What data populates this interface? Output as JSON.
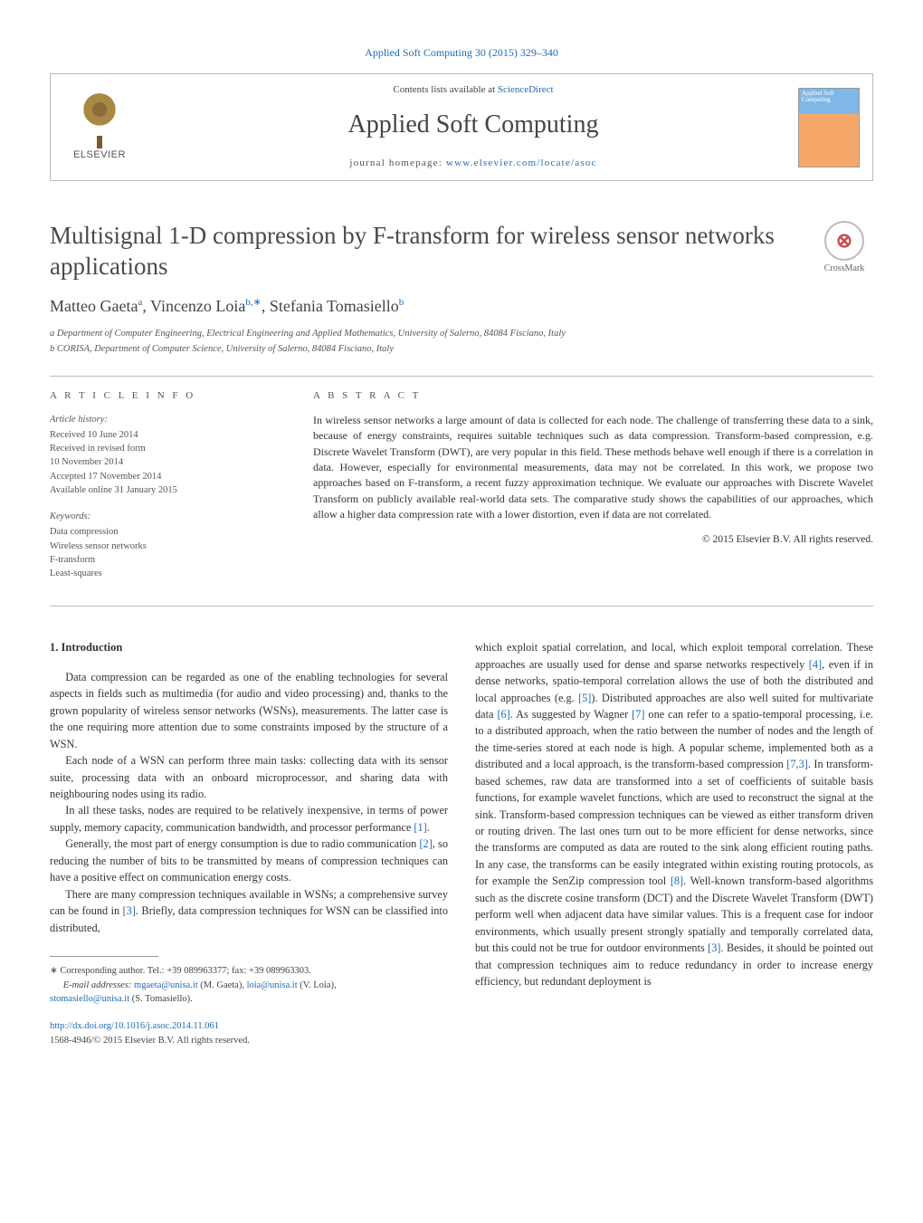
{
  "journal_ref": {
    "text": "Applied Soft Computing 30 (2015) 329–340",
    "href_text": "Applied Soft Computing 30 (2015) 329–340"
  },
  "header": {
    "elsevier": "ELSEVIER",
    "contents_prefix": "Contents lists available at ",
    "contents_link": "ScienceDirect",
    "journal_name": "Applied Soft Computing",
    "homepage_prefix": "journal homepage: ",
    "homepage_link": "www.elsevier.com/locate/asoc",
    "cover_text": "Applied Soft Computing"
  },
  "title": "Multisignal 1-D compression by F-transform for wireless sensor networks applications",
  "crossmark": "CrossMark",
  "authors_html": "Matteo Gaeta",
  "authors": {
    "a1_name": "Matteo Gaeta",
    "a1_sup": "a",
    "sep1": ", ",
    "a2_name": "Vincenzo Loia",
    "a2_sup": "b,",
    "a2_star": "∗",
    "sep2": ", ",
    "a3_name": "Stefania Tomasiello",
    "a3_sup": "b"
  },
  "affiliations": {
    "a": "a Department of Computer Engineering, Electrical Engineering and Applied Mathematics, University of Salerno, 84084 Fisciano, Italy",
    "b": "b CORISA, Department of Computer Science, University of Salerno, 84084 Fisciano, Italy"
  },
  "article_info": {
    "heading": "A R T I C L E   I N F O",
    "history_label": "Article history:",
    "history": [
      "Received 10 June 2014",
      "Received in revised form",
      "10 November 2014",
      "Accepted 17 November 2014",
      "Available online 31 January 2015"
    ],
    "keywords_label": "Keywords:",
    "keywords": [
      "Data compression",
      "Wireless sensor networks",
      "F-transform",
      "Least-squares"
    ]
  },
  "abstract": {
    "heading": "A B S T R A C T",
    "text": "In wireless sensor networks a large amount of data is collected for each node. The challenge of transferring these data to a sink, because of energy constraints, requires suitable techniques such as data compression. Transform-based compression, e.g. Discrete Wavelet Transform (DWT), are very popular in this field. These methods behave well enough if there is a correlation in data. However, especially for environmental measurements, data may not be correlated. In this work, we propose two approaches based on F-transform, a recent fuzzy approximation technique. We evaluate our approaches with Discrete Wavelet Transform on publicly available real-world data sets. The comparative study shows the capabilities of our approaches, which allow a higher data compression rate with a lower distortion, even if data are not correlated.",
    "copyright": "© 2015 Elsevier B.V. All rights reserved."
  },
  "section1": {
    "heading": "1.  Introduction",
    "p1": "Data compression can be regarded as one of the enabling technologies for several aspects in fields such as multimedia (for audio and video processing) and, thanks to the grown popularity of wireless sensor networks (WSNs), measurements. The latter case is the one requiring more attention due to some constraints imposed by the structure of a WSN.",
    "p2": "Each node of a WSN can perform three main tasks: collecting data with its sensor suite, processing data with an onboard microprocessor, and sharing data with neighbouring nodes using its radio.",
    "p3_a": "In all these tasks, nodes are required to be relatively inexpensive, in terms of power supply, memory capacity, communication bandwidth, and processor performance ",
    "p3_ref": "[1]",
    "p3_b": ".",
    "p4_a": "Generally, the most part of energy consumption is due to radio communication ",
    "p4_ref": "[2]",
    "p4_b": ", so reducing the number of bits to be transmitted by means of compression techniques can have a positive effect on communication energy costs.",
    "p5_a": "There are many compression techniques available in WSNs; a comprehensive survey can be found in ",
    "p5_ref": "[3]",
    "p5_b": ". Briefly, data compression techniques for WSN can be classified into distributed, ",
    "col2_a": "which exploit spatial correlation, and local, which exploit temporal correlation. These approaches are usually used for dense and sparse networks respectively ",
    "r4": "[4]",
    "col2_b": ", even if in dense networks, spatio-temporal correlation allows the use of both the distributed and local approaches (e.g. ",
    "r5": "[5]",
    "col2_c": "). Distributed approaches are also well suited for multivariate data ",
    "r6": "[6]",
    "col2_d": ". As suggested by Wagner ",
    "r7": "[7]",
    "col2_e": " one can refer to a spatio-temporal processing, i.e. to a distributed approach, when the ratio between the number of nodes and the length of the time-series stored at each node is high. A popular scheme, implemented both as a distributed and a local approach, is the transform-based compression ",
    "r73": "[7,3]",
    "col2_f": ". In transform-based schemes, raw data are transformed into a set of coefficients of suitable basis functions, for example wavelet functions, which are used to reconstruct the signal at the sink. Transform-based compression techniques can be viewed as either transform driven or routing driven. The last ones turn out to be more efficient for dense networks, since the transforms are computed as data are routed to the sink along efficient routing paths. In any case, the transforms can be easily integrated within existing routing protocols, as for example the SenZip compression tool ",
    "r8": "[8]",
    "col2_g": ". Well-known transform-based algorithms such as the discrete cosine transform (DCT) and the Discrete Wavelet Transform (DWT) perform well when adjacent data have similar values. This is a frequent case for indoor environments, which usually present strongly spatially and temporally correlated data, but this could not be true for outdoor environments ",
    "r3b": "[3]",
    "col2_h": ". Besides, it should be pointed out that compression techniques aim to reduce redundancy in order to increase energy efficiency, but redundant deployment is"
  },
  "footnotes": {
    "corr": "∗ Corresponding author. Tel.: +39 089963377; fax: +39 089963303.",
    "email_label": "E-mail addresses: ",
    "e1": "mgaeta@unisa.it",
    "e1_who": " (M. Gaeta), ",
    "e2": "loia@unisa.it",
    "e2_who": " (V. Loia), ",
    "e3": "stomasiello@unisa.it",
    "e3_who": " (S. Tomasiello)."
  },
  "doi": {
    "link": "http://dx.doi.org/10.1016/j.asoc.2014.11.061",
    "issn": "1568-4946/© 2015 Elsevier B.V. All rights reserved."
  }
}
